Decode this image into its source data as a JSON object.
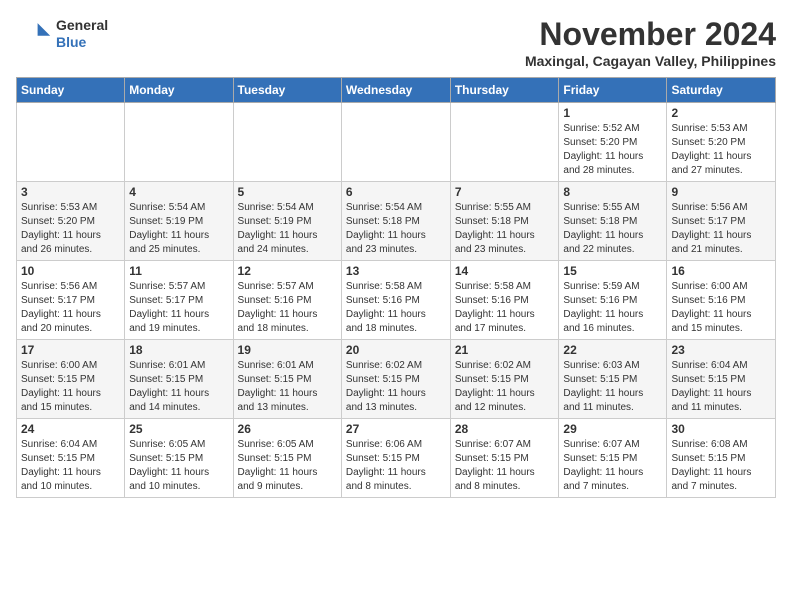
{
  "header": {
    "logo_line1": "General",
    "logo_line2": "Blue",
    "month": "November 2024",
    "location": "Maxingal, Cagayan Valley, Philippines"
  },
  "weekdays": [
    "Sunday",
    "Monday",
    "Tuesday",
    "Wednesday",
    "Thursday",
    "Friday",
    "Saturday"
  ],
  "weeks": [
    [
      {
        "day": "",
        "info": ""
      },
      {
        "day": "",
        "info": ""
      },
      {
        "day": "",
        "info": ""
      },
      {
        "day": "",
        "info": ""
      },
      {
        "day": "",
        "info": ""
      },
      {
        "day": "1",
        "info": "Sunrise: 5:52 AM\nSunset: 5:20 PM\nDaylight: 11 hours\nand 28 minutes."
      },
      {
        "day": "2",
        "info": "Sunrise: 5:53 AM\nSunset: 5:20 PM\nDaylight: 11 hours\nand 27 minutes."
      }
    ],
    [
      {
        "day": "3",
        "info": "Sunrise: 5:53 AM\nSunset: 5:20 PM\nDaylight: 11 hours\nand 26 minutes."
      },
      {
        "day": "4",
        "info": "Sunrise: 5:54 AM\nSunset: 5:19 PM\nDaylight: 11 hours\nand 25 minutes."
      },
      {
        "day": "5",
        "info": "Sunrise: 5:54 AM\nSunset: 5:19 PM\nDaylight: 11 hours\nand 24 minutes."
      },
      {
        "day": "6",
        "info": "Sunrise: 5:54 AM\nSunset: 5:18 PM\nDaylight: 11 hours\nand 23 minutes."
      },
      {
        "day": "7",
        "info": "Sunrise: 5:55 AM\nSunset: 5:18 PM\nDaylight: 11 hours\nand 23 minutes."
      },
      {
        "day": "8",
        "info": "Sunrise: 5:55 AM\nSunset: 5:18 PM\nDaylight: 11 hours\nand 22 minutes."
      },
      {
        "day": "9",
        "info": "Sunrise: 5:56 AM\nSunset: 5:17 PM\nDaylight: 11 hours\nand 21 minutes."
      }
    ],
    [
      {
        "day": "10",
        "info": "Sunrise: 5:56 AM\nSunset: 5:17 PM\nDaylight: 11 hours\nand 20 minutes."
      },
      {
        "day": "11",
        "info": "Sunrise: 5:57 AM\nSunset: 5:17 PM\nDaylight: 11 hours\nand 19 minutes."
      },
      {
        "day": "12",
        "info": "Sunrise: 5:57 AM\nSunset: 5:16 PM\nDaylight: 11 hours\nand 18 minutes."
      },
      {
        "day": "13",
        "info": "Sunrise: 5:58 AM\nSunset: 5:16 PM\nDaylight: 11 hours\nand 18 minutes."
      },
      {
        "day": "14",
        "info": "Sunrise: 5:58 AM\nSunset: 5:16 PM\nDaylight: 11 hours\nand 17 minutes."
      },
      {
        "day": "15",
        "info": "Sunrise: 5:59 AM\nSunset: 5:16 PM\nDaylight: 11 hours\nand 16 minutes."
      },
      {
        "day": "16",
        "info": "Sunrise: 6:00 AM\nSunset: 5:16 PM\nDaylight: 11 hours\nand 15 minutes."
      }
    ],
    [
      {
        "day": "17",
        "info": "Sunrise: 6:00 AM\nSunset: 5:15 PM\nDaylight: 11 hours\nand 15 minutes."
      },
      {
        "day": "18",
        "info": "Sunrise: 6:01 AM\nSunset: 5:15 PM\nDaylight: 11 hours\nand 14 minutes."
      },
      {
        "day": "19",
        "info": "Sunrise: 6:01 AM\nSunset: 5:15 PM\nDaylight: 11 hours\nand 13 minutes."
      },
      {
        "day": "20",
        "info": "Sunrise: 6:02 AM\nSunset: 5:15 PM\nDaylight: 11 hours\nand 13 minutes."
      },
      {
        "day": "21",
        "info": "Sunrise: 6:02 AM\nSunset: 5:15 PM\nDaylight: 11 hours\nand 12 minutes."
      },
      {
        "day": "22",
        "info": "Sunrise: 6:03 AM\nSunset: 5:15 PM\nDaylight: 11 hours\nand 11 minutes."
      },
      {
        "day": "23",
        "info": "Sunrise: 6:04 AM\nSunset: 5:15 PM\nDaylight: 11 hours\nand 11 minutes."
      }
    ],
    [
      {
        "day": "24",
        "info": "Sunrise: 6:04 AM\nSunset: 5:15 PM\nDaylight: 11 hours\nand 10 minutes."
      },
      {
        "day": "25",
        "info": "Sunrise: 6:05 AM\nSunset: 5:15 PM\nDaylight: 11 hours\nand 10 minutes."
      },
      {
        "day": "26",
        "info": "Sunrise: 6:05 AM\nSunset: 5:15 PM\nDaylight: 11 hours\nand 9 minutes."
      },
      {
        "day": "27",
        "info": "Sunrise: 6:06 AM\nSunset: 5:15 PM\nDaylight: 11 hours\nand 8 minutes."
      },
      {
        "day": "28",
        "info": "Sunrise: 6:07 AM\nSunset: 5:15 PM\nDaylight: 11 hours\nand 8 minutes."
      },
      {
        "day": "29",
        "info": "Sunrise: 6:07 AM\nSunset: 5:15 PM\nDaylight: 11 hours\nand 7 minutes."
      },
      {
        "day": "30",
        "info": "Sunrise: 6:08 AM\nSunset: 5:15 PM\nDaylight: 11 hours\nand 7 minutes."
      }
    ]
  ]
}
